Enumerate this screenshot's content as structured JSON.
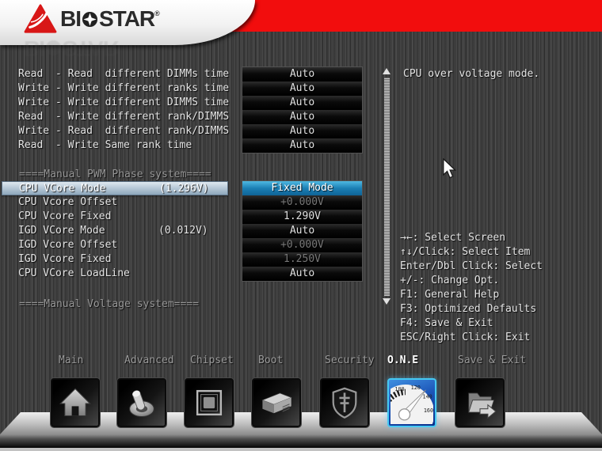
{
  "brand": {
    "name1": "BI",
    "name2": "STAR",
    "reg": "®"
  },
  "timing": {
    "labels": [
      "Read  - Read  different DIMMs time",
      "Write - Write different ranks time",
      "Write - Write different DIMMS time",
      "Read  - Write different rank/DIMMS",
      "Write - Read  different rank/DIMMS",
      "Read  - Write Same rank time"
    ],
    "values": [
      "Auto",
      "Auto",
      "Auto",
      "Auto",
      "Auto",
      "Auto"
    ]
  },
  "pwm": {
    "header": "====Manual PWM Phase system====",
    "rows": [
      {
        "label": "CPU VCore Mode",
        "note": "(1.296V)",
        "value": "Fixed Mode",
        "state": "selected"
      },
      {
        "label": "CPU Vcore Offset",
        "note": "",
        "value": "+0.000V",
        "state": "disabled"
      },
      {
        "label": "CPU Vcore Fixed",
        "note": "",
        "value": "1.290V",
        "state": "normal"
      },
      {
        "label": "IGD VCore Mode",
        "note": "(0.012V)",
        "value": "Auto",
        "state": "normal"
      },
      {
        "label": "IGD Vcore Offset",
        "note": "",
        "value": "+0.000V",
        "state": "disabled"
      },
      {
        "label": "IGD Vcore Fixed",
        "note": "",
        "value": "1.250V",
        "state": "disabled"
      },
      {
        "label": "CPU VCore LoadLine",
        "note": "",
        "value": "Auto",
        "state": "normal"
      }
    ]
  },
  "voltage_header": "====Manual Voltage system====",
  "help": {
    "description": "CPU over voltage mode.",
    "keys": [
      "→←: Select Screen",
      "↑↓/Click: Select Item",
      "Enter/Dbl Click: Select",
      "+/-: Change Opt.",
      "F1: General Help",
      "F3: Optimized Defaults",
      "F4: Save & Exit",
      "ESC/Right Click: Exit"
    ]
  },
  "menu": {
    "items": [
      "Main",
      "Advanced",
      "Chipset",
      "Boot",
      "Security",
      "O.N.E",
      "Save & Exit"
    ],
    "active": "O.N.E"
  },
  "dock": {
    "tiles": [
      "home",
      "advanced-toggle",
      "chipset",
      "boot-drive",
      "security-shield",
      "one-gauge",
      "save-exit-folder"
    ],
    "active": "one-gauge",
    "gauge_labels": [
      "100",
      "120",
      "140",
      "160"
    ]
  },
  "colors": {
    "brand_red": "#f20d0d",
    "selected_row_blue_top": "#4fb9e2",
    "selected_row_blue_bottom": "#0f6396",
    "selected_label_row": "#b9cad8",
    "active_tile_border": "#45c8f2"
  }
}
